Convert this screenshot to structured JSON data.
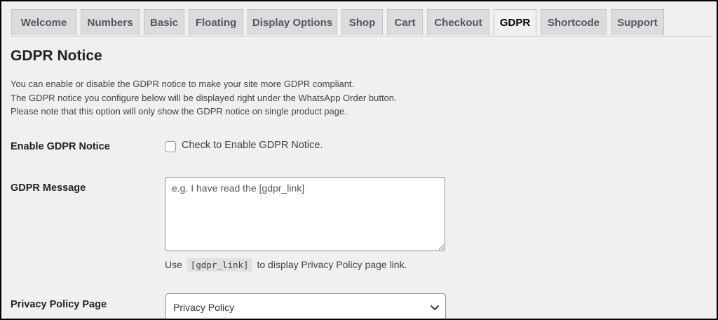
{
  "tabs": [
    {
      "label": "Welcome",
      "active": false
    },
    {
      "label": "Numbers",
      "active": false
    },
    {
      "label": "Basic",
      "active": false
    },
    {
      "label": "Floating",
      "active": false
    },
    {
      "label": "Display Options",
      "active": false
    },
    {
      "label": "Shop",
      "active": false
    },
    {
      "label": "Cart",
      "active": false
    },
    {
      "label": "Checkout",
      "active": false
    },
    {
      "label": "GDPR",
      "active": true
    },
    {
      "label": "Shortcode",
      "active": false
    },
    {
      "label": "Support",
      "active": false
    }
  ],
  "section": {
    "title": "GDPR Notice",
    "description": [
      "You can enable or disable the GDPR notice to make your site more GDPR compliant.",
      "The GDPR notice you configure below will be displayed right under the WhatsApp Order button.",
      "Please note that this option will only show the GDPR notice on single product page."
    ]
  },
  "enable_gdpr": {
    "label": "Enable GDPR Notice",
    "checkbox_label": "Check to Enable GDPR Notice.",
    "checked": false
  },
  "gdpr_message": {
    "label": "GDPR Message",
    "value": "",
    "placeholder": "e.g. I have read the [gdpr_link]",
    "help_prefix": "Use",
    "help_code": "[gdpr_link]",
    "help_suffix": "to display Privacy Policy page link."
  },
  "privacy_policy": {
    "label": "Privacy Policy Page",
    "selected": "Privacy Policy"
  }
}
